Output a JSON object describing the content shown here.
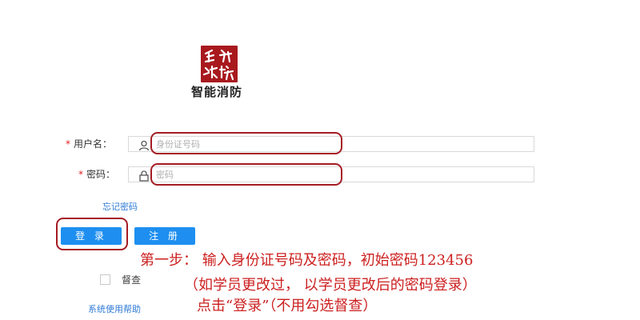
{
  "brand": {
    "app_title": "智能消防",
    "logo_icon": "seal-logo",
    "logo_color": "#a8191e"
  },
  "form": {
    "username": {
      "label": "用户名：",
      "placeholder": "身份证号码",
      "icon": "user-icon"
    },
    "password": {
      "label": "密码：",
      "placeholder": "密码",
      "icon": "lock-icon"
    },
    "required_mark": "*",
    "forgot_password": "忘记密码",
    "login_button": "登 录",
    "register_button": "注 册",
    "supervise_label": "督查",
    "help_link": "系统使用帮助"
  },
  "instructions": {
    "line1": "第一步： 输入身份证号码及密码，初始密码123456",
    "line2": "（如学员更改过， 以学员更改后的密码登录）",
    "line3": "点击“登录”（不用勾选督查）"
  },
  "colors": {
    "primary_button": "#1e8ff0",
    "link": "#2f7bd6",
    "required": "#e02020",
    "annotation": "#cc1f1f",
    "callout": "#a51c24"
  }
}
